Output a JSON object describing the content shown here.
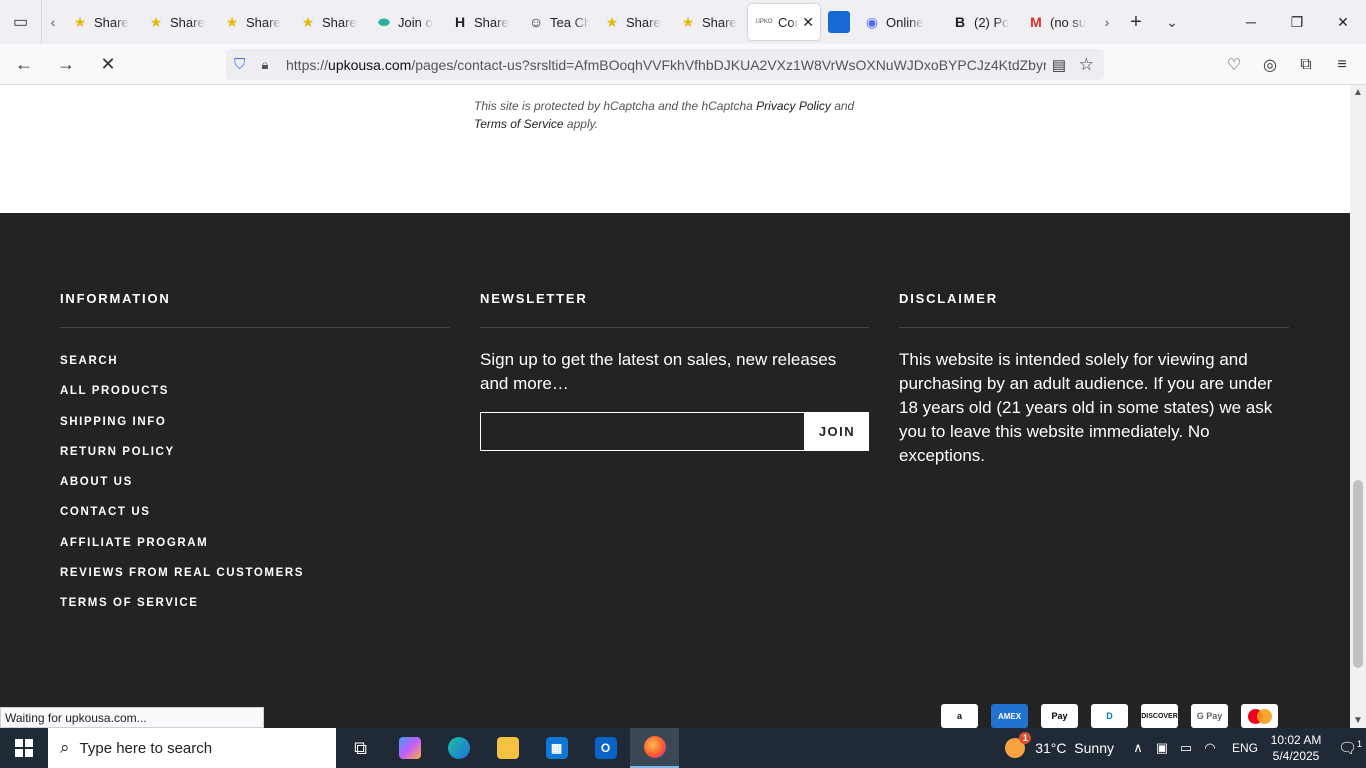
{
  "browser": {
    "tabs": [
      {
        "title": "Share",
        "icon": "star-icon"
      },
      {
        "title": "Share",
        "icon": "star-icon"
      },
      {
        "title": "Share",
        "icon": "star-icon"
      },
      {
        "title": "Share",
        "icon": "star-icon"
      },
      {
        "title": "Join o",
        "icon": "join-icon"
      },
      {
        "title": "Share",
        "icon": "h-icon"
      },
      {
        "title": "Tea Ch",
        "icon": "tea-icon"
      },
      {
        "title": "Share",
        "icon": "star-icon"
      },
      {
        "title": "Share",
        "icon": "star-icon"
      },
      {
        "title": "Cor",
        "icon": "upko-icon",
        "active": true
      },
      {
        "title": "",
        "icon": "blue-square-icon"
      },
      {
        "title": "Online",
        "icon": "online-icon"
      },
      {
        "title": "(2) Po",
        "icon": "b-icon"
      },
      {
        "title": "(no su",
        "icon": "gmail-icon"
      }
    ],
    "url_domain": "upkousa.com",
    "url_prefix": "https://",
    "url_path": "/pages/contact-us?srsltid=AfmBOoqhVVFkhVfhbDJKUA2VXz1W8VrWsOXNuWJDxoBYPCJz4KtdZbyr",
    "status_text": "Waiting for upkousa.com..."
  },
  "page": {
    "captcha_pre": "This site is protected by hCaptcha and the hCaptcha ",
    "captcha_privacy": "Privacy Policy",
    "captcha_and": " and ",
    "captcha_terms": "Terms of Service",
    "captcha_post": " apply.",
    "footer": {
      "information": {
        "heading": "INFORMATION",
        "links": [
          "SEARCH",
          "ALL PRODUCTS",
          "SHIPPING INFO",
          "RETURN POLICY",
          "ABOUT US",
          "CONTACT US",
          "AFFILIATE PROGRAM",
          "REVIEWS FROM REAL CUSTOMERS",
          "TERMS OF SERVICE"
        ]
      },
      "newsletter": {
        "heading": "NEWSLETTER",
        "text": "Sign up to get the latest on sales, new releases and more…",
        "input_value": "",
        "button": "JOIN"
      },
      "disclaimer": {
        "heading": "DISCLAIMER",
        "text": "This website is intended solely for viewing and purchasing by an adult audience. If you are under 18 years old (21 years old in some states) we ask you to leave this website immediately. No exceptions."
      },
      "payments": {
        "amazon": "a",
        "amex": "AMEX",
        "apple": "Pay",
        "diners": "D",
        "discover": "DISCOVER",
        "gpay": "G Pay"
      }
    }
  },
  "taskbar": {
    "search_placeholder": "Type here to search",
    "weather_temp": "31°C",
    "weather_cond": "Sunny",
    "weather_badge": "1",
    "lang": "ENG",
    "time": "10:02 AM",
    "date": "5/4/2025",
    "notif_count": "1"
  }
}
